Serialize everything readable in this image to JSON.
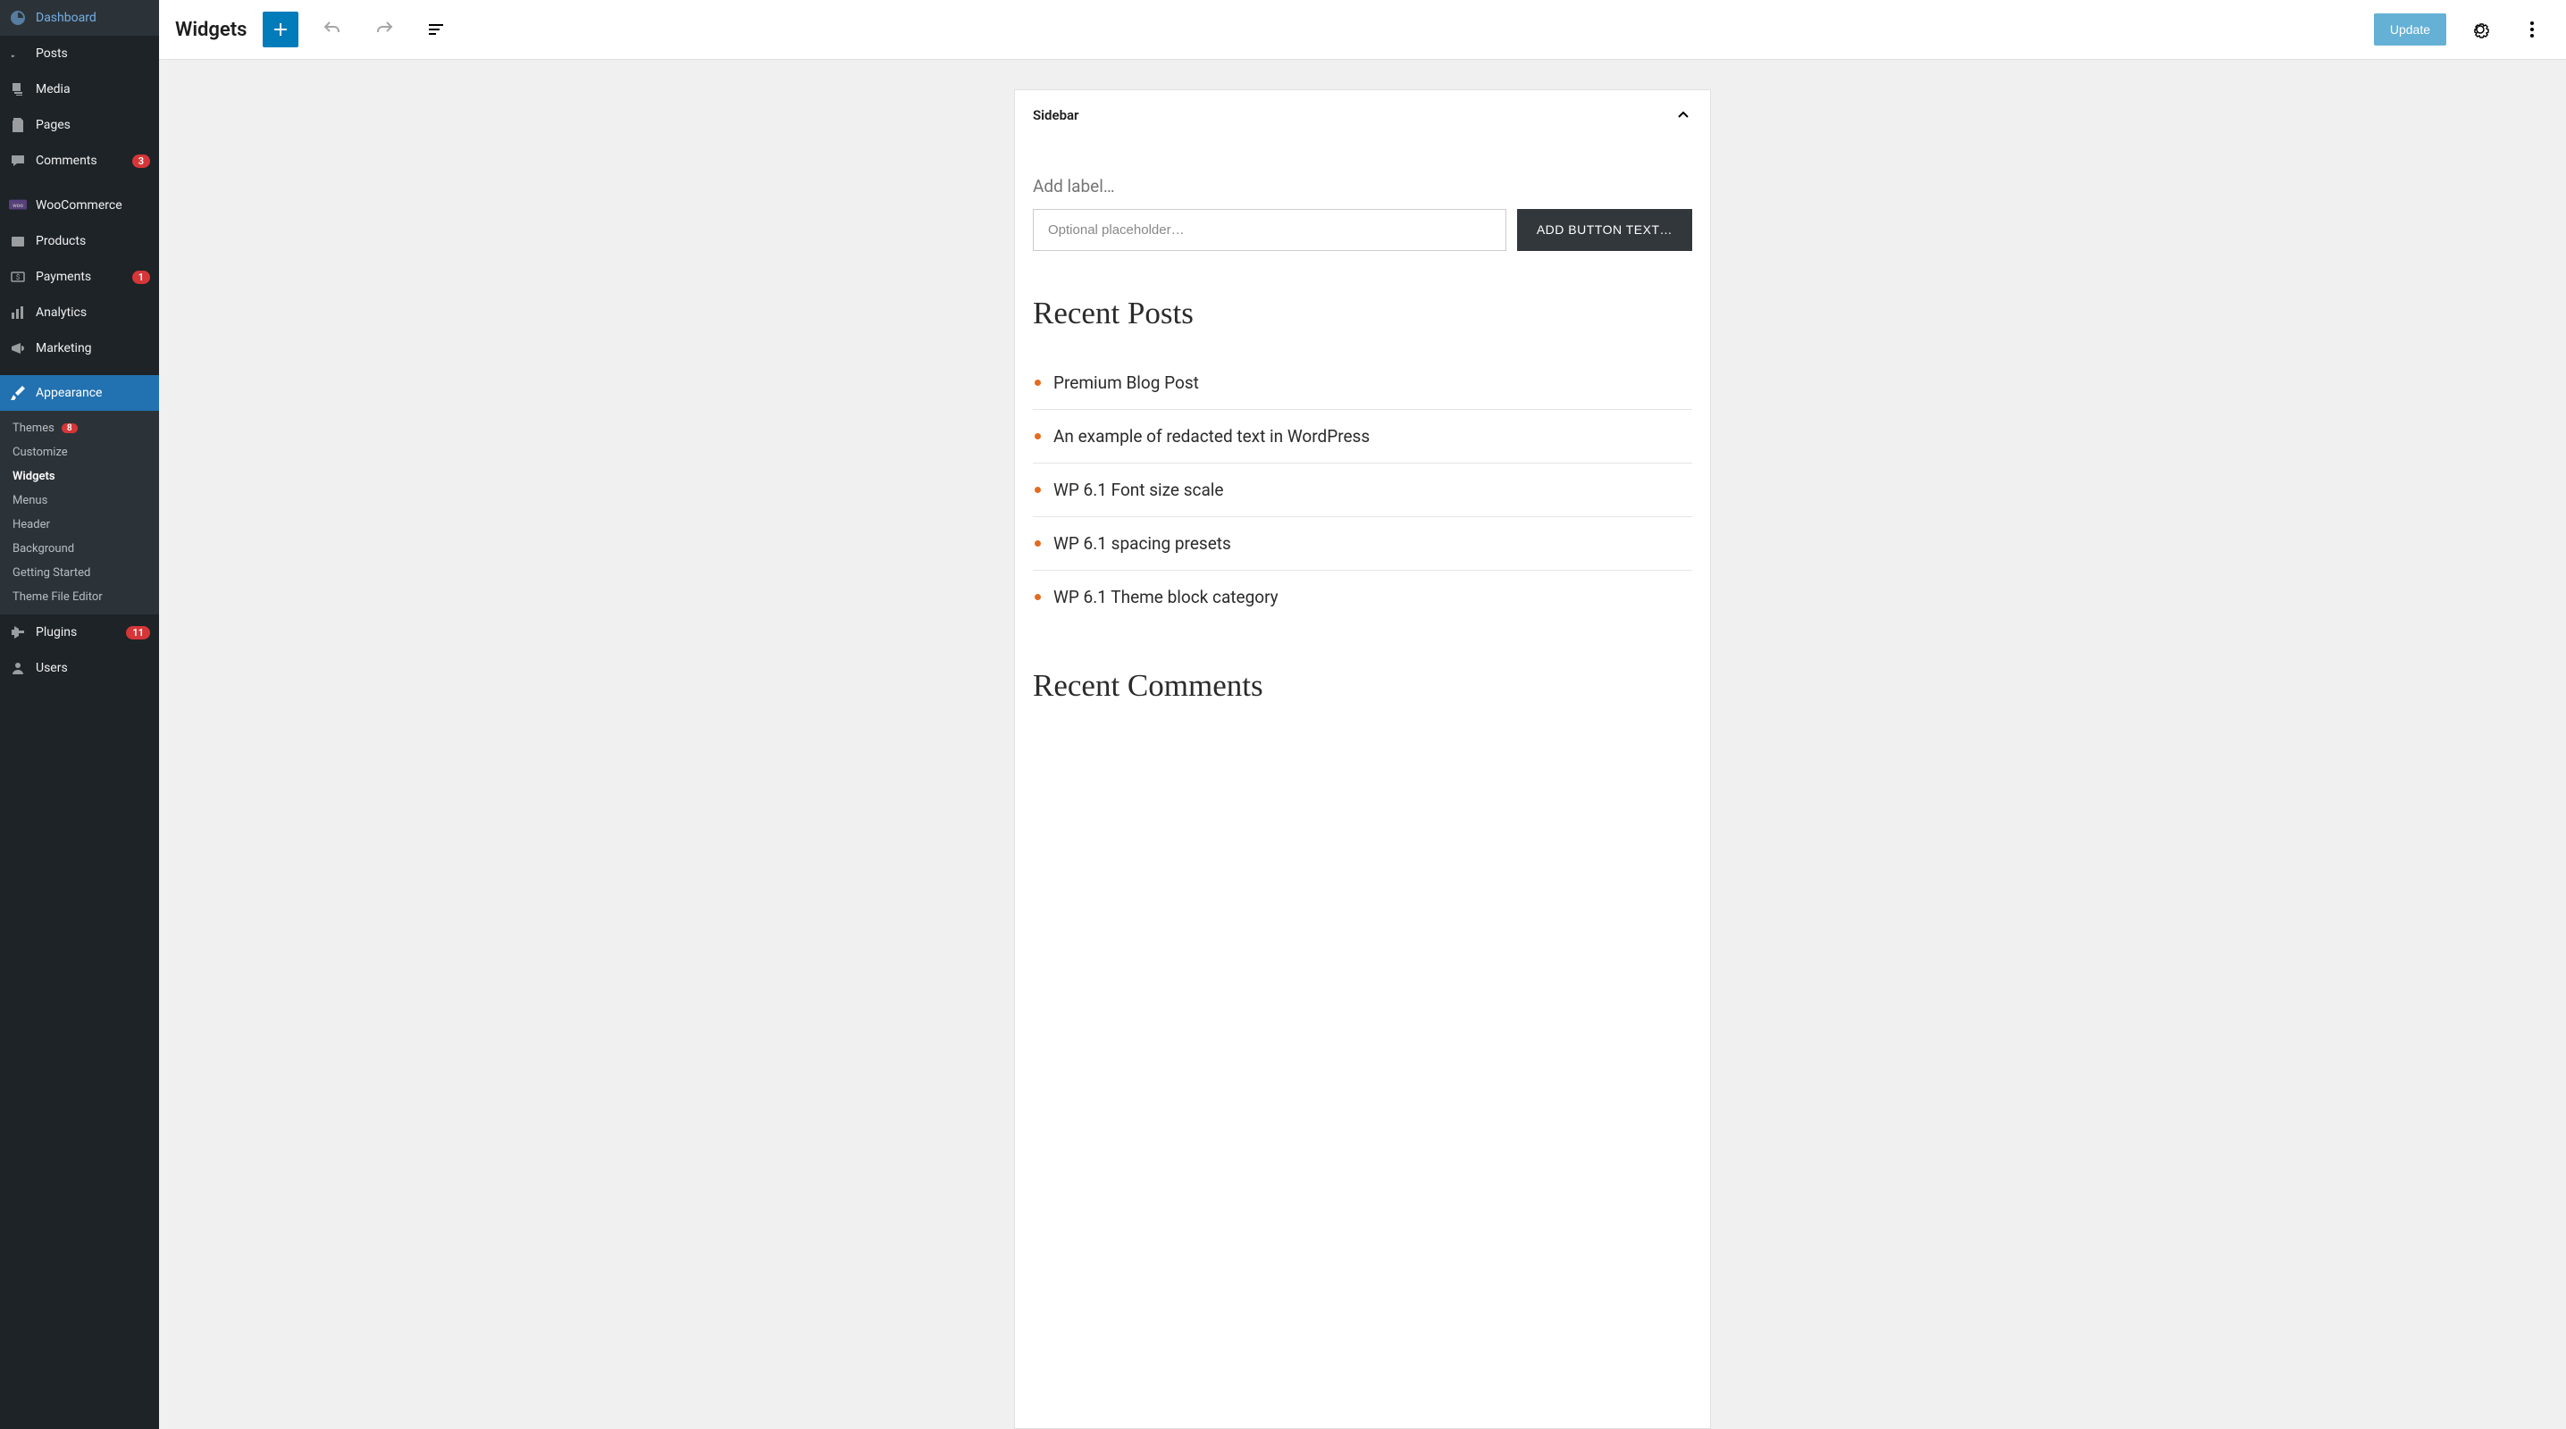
{
  "sidebar": {
    "items": [
      {
        "label": "Dashboard",
        "icon": "dashboard"
      },
      {
        "label": "Posts",
        "icon": "pin"
      },
      {
        "label": "Media",
        "icon": "media"
      },
      {
        "label": "Pages",
        "icon": "pages"
      },
      {
        "label": "Comments",
        "icon": "comment",
        "badge": "3"
      },
      {
        "label": "WooCommerce",
        "icon": "woo"
      },
      {
        "label": "Products",
        "icon": "products"
      },
      {
        "label": "Payments",
        "icon": "payments",
        "badge": "1"
      },
      {
        "label": "Analytics",
        "icon": "analytics"
      },
      {
        "label": "Marketing",
        "icon": "marketing"
      },
      {
        "label": "Appearance",
        "icon": "brush",
        "active": true
      },
      {
        "label": "Plugins",
        "icon": "plugin",
        "badge": "11"
      },
      {
        "label": "Users",
        "icon": "users"
      }
    ],
    "submenu": [
      {
        "label": "Themes",
        "badge": "8"
      },
      {
        "label": "Customize"
      },
      {
        "label": "Widgets",
        "current": true
      },
      {
        "label": "Menus"
      },
      {
        "label": "Header"
      },
      {
        "label": "Background"
      },
      {
        "label": "Getting Started"
      },
      {
        "label": "Theme File Editor"
      }
    ]
  },
  "topbar": {
    "title": "Widgets",
    "update_label": "Update"
  },
  "widget_area": {
    "title": "Sidebar",
    "search": {
      "label": "Add label…",
      "placeholder": "Optional placeholder…",
      "button": "ADD BUTTON TEXT…"
    },
    "recent_posts": {
      "heading": "Recent Posts",
      "items": [
        "Premium Blog Post",
        "An example of redacted text in WordPress",
        "WP 6.1 Font size scale",
        "WP 6.1 spacing presets",
        "WP 6.1 Theme block category"
      ]
    },
    "recent_comments": {
      "heading": "Recent Comments"
    }
  }
}
